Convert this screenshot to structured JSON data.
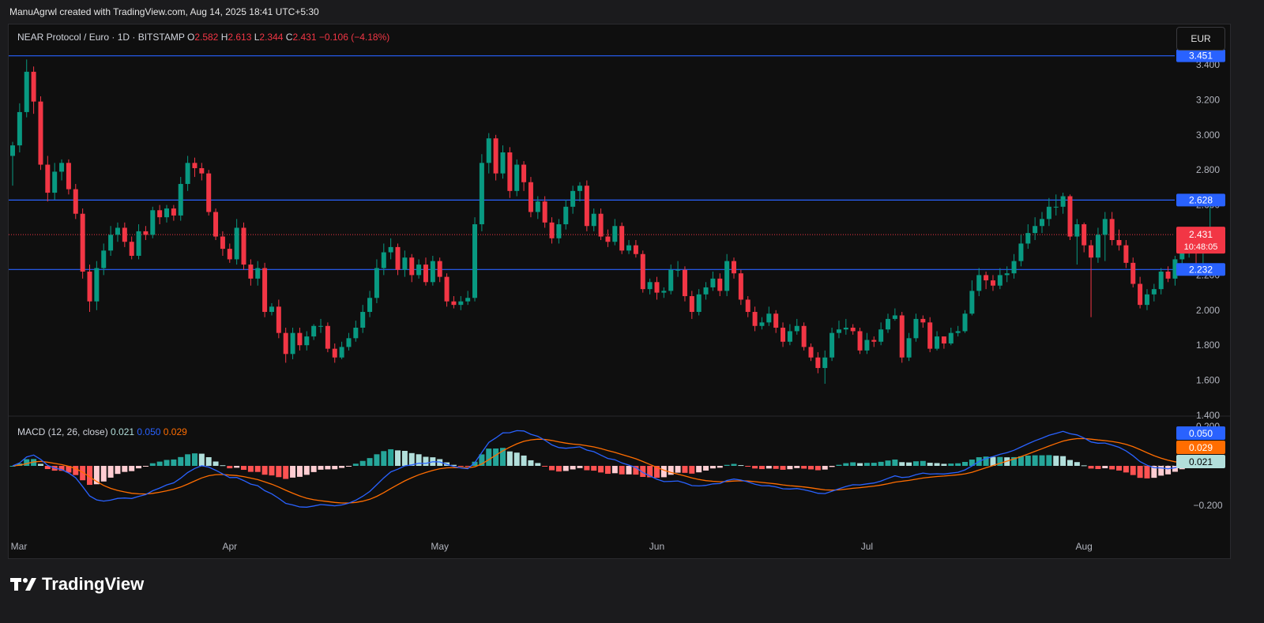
{
  "caption": "ManuAgrwl created with TradingView.com, Aug 14, 2025 18:41 UTC+5:30",
  "header": {
    "symbol": "NEAR Protocol / Euro · 1D · BITSTAMP",
    "o_label": "O",
    "o": "2.582",
    "h_label": "H",
    "h": "2.613",
    "l_label": "L",
    "l": "2.344",
    "c_label": "C",
    "c": "2.431",
    "change": "−0.106 (−4.18%)"
  },
  "currency_button": "EUR",
  "macd_header": {
    "label": "MACD (12, 26, close)",
    "hist": "0.021",
    "macd": "0.050",
    "signal": "0.029"
  },
  "brand": "TradingView",
  "colors": {
    "up": "#089981",
    "down": "#f23645",
    "level": "#2962ff",
    "macd": "#2962ff",
    "signal": "#ff6d00",
    "hist_up_strong": "#26a69a",
    "hist_up_weak": "#b2dfdb",
    "hist_down_strong": "#ff5252",
    "hist_down_weak": "#ffcdd2"
  },
  "chart_data": [
    {
      "type": "candlestick",
      "title": "NEAR Protocol / Euro · 1D · BITSTAMP",
      "y_ticks": [
        "3.400",
        "3.200",
        "3.000",
        "2.800",
        "2.600",
        "2.400",
        "2.200",
        "2.000",
        "1.800",
        "1.600",
        "1.400"
      ],
      "x_ticks": [
        "Mar",
        "Apr",
        "May",
        "Jun",
        "Jul",
        "Aug"
      ],
      "ylim": [
        1.4,
        3.45
      ],
      "horizontal_levels": [
        {
          "value": 3.451,
          "label": "3.451"
        },
        {
          "value": 2.628,
          "label": "2.628"
        },
        {
          "value": 2.232,
          "label": "2.232"
        }
      ],
      "last_price": {
        "value": 2.431,
        "label": "2.431",
        "countdown": "10:48:05"
      },
      "dates": [
        "2025-03-01",
        "2025-03-02",
        "2025-03-03",
        "2025-03-04",
        "2025-03-05",
        "2025-03-06",
        "2025-03-07",
        "2025-03-08",
        "2025-03-09",
        "2025-03-10",
        "2025-03-11",
        "2025-03-12",
        "2025-03-13",
        "2025-03-14",
        "2025-03-15",
        "2025-03-16",
        "2025-03-17",
        "2025-03-18",
        "2025-03-19",
        "2025-03-20",
        "2025-03-21",
        "2025-03-22",
        "2025-03-23",
        "2025-03-24",
        "2025-03-25",
        "2025-03-26",
        "2025-03-27",
        "2025-03-28",
        "2025-03-29",
        "2025-03-30",
        "2025-03-31",
        "2025-04-01",
        "2025-04-02",
        "2025-04-03",
        "2025-04-04",
        "2025-04-05",
        "2025-04-06",
        "2025-04-07",
        "2025-04-08",
        "2025-04-09",
        "2025-04-10",
        "2025-04-11",
        "2025-04-12",
        "2025-04-13",
        "2025-04-14",
        "2025-04-15",
        "2025-04-16",
        "2025-04-17",
        "2025-04-18",
        "2025-04-19",
        "2025-04-20",
        "2025-04-21",
        "2025-04-22",
        "2025-04-23",
        "2025-04-24",
        "2025-04-25",
        "2025-04-26",
        "2025-04-27",
        "2025-04-28",
        "2025-04-29",
        "2025-04-30",
        "2025-05-01",
        "2025-05-02",
        "2025-05-03",
        "2025-05-04",
        "2025-05-05",
        "2025-05-06",
        "2025-05-07",
        "2025-05-08",
        "2025-05-09",
        "2025-05-10",
        "2025-05-11",
        "2025-05-12",
        "2025-05-13",
        "2025-05-14",
        "2025-05-15",
        "2025-05-16",
        "2025-05-17",
        "2025-05-18",
        "2025-05-19",
        "2025-05-20",
        "2025-05-21",
        "2025-05-22",
        "2025-05-23",
        "2025-05-24",
        "2025-05-25",
        "2025-05-26",
        "2025-05-27",
        "2025-05-28",
        "2025-05-29",
        "2025-05-30",
        "2025-05-31",
        "2025-06-01",
        "2025-06-02",
        "2025-06-03",
        "2025-06-04",
        "2025-06-05",
        "2025-06-06",
        "2025-06-07",
        "2025-06-08",
        "2025-06-09",
        "2025-06-10",
        "2025-06-11",
        "2025-06-12",
        "2025-06-13",
        "2025-06-14",
        "2025-06-15",
        "2025-06-16",
        "2025-06-17",
        "2025-06-18",
        "2025-06-19",
        "2025-06-20",
        "2025-06-21",
        "2025-06-22",
        "2025-06-23",
        "2025-06-24",
        "2025-06-25",
        "2025-06-26",
        "2025-06-27",
        "2025-06-28",
        "2025-06-29",
        "2025-06-30",
        "2025-07-01",
        "2025-07-02",
        "2025-07-03",
        "2025-07-04",
        "2025-07-05",
        "2025-07-06",
        "2025-07-07",
        "2025-07-08",
        "2025-07-09",
        "2025-07-10",
        "2025-07-11",
        "2025-07-12",
        "2025-07-13",
        "2025-07-14",
        "2025-07-15",
        "2025-07-16",
        "2025-07-17",
        "2025-07-18",
        "2025-07-19",
        "2025-07-20",
        "2025-07-21",
        "2025-07-22",
        "2025-07-23",
        "2025-07-24",
        "2025-07-25",
        "2025-07-26",
        "2025-07-27",
        "2025-07-28",
        "2025-07-29",
        "2025-07-30",
        "2025-07-31",
        "2025-08-01",
        "2025-08-02",
        "2025-08-03",
        "2025-08-04",
        "2025-08-05",
        "2025-08-06",
        "2025-08-07",
        "2025-08-08",
        "2025-08-09",
        "2025-08-10",
        "2025-08-11",
        "2025-08-12",
        "2025-08-13",
        "2025-08-14"
      ],
      "close": [
        2.94,
        3.13,
        3.36,
        3.19,
        2.83,
        2.67,
        2.79,
        2.84,
        2.69,
        2.55,
        2.22,
        2.05,
        2.24,
        2.34,
        2.43,
        2.47,
        2.39,
        2.31,
        2.45,
        2.43,
        2.57,
        2.53,
        2.58,
        2.54,
        2.72,
        2.84,
        2.81,
        2.78,
        2.56,
        2.42,
        2.35,
        2.29,
        2.47,
        2.26,
        2.18,
        2.24,
        1.99,
        2.02,
        1.87,
        1.75,
        1.87,
        1.8,
        1.85,
        1.91,
        1.91,
        1.78,
        1.73,
        1.79,
        1.84,
        1.9,
        1.99,
        2.07,
        2.24,
        2.33,
        2.36,
        2.23,
        2.3,
        2.2,
        2.26,
        2.16,
        2.28,
        2.19,
        2.05,
        2.03,
        2.05,
        2.07,
        2.49,
        2.84,
        2.98,
        2.78,
        2.9,
        2.68,
        2.83,
        2.73,
        2.56,
        2.62,
        2.5,
        2.41,
        2.49,
        2.59,
        2.68,
        2.71,
        2.48,
        2.55,
        2.42,
        2.39,
        2.48,
        2.34,
        2.37,
        2.32,
        2.12,
        2.16,
        2.1,
        2.11,
        2.23,
        2.23,
        2.08,
        1.99,
        2.09,
        2.13,
        2.18,
        2.11,
        2.28,
        2.21,
        2.06,
        1.99,
        1.91,
        1.93,
        1.98,
        1.9,
        1.82,
        1.88,
        1.91,
        1.79,
        1.73,
        1.67,
        1.73,
        1.87,
        1.89,
        1.9,
        1.88,
        1.77,
        1.83,
        1.82,
        1.89,
        1.95,
        1.97,
        1.73,
        1.84,
        1.95,
        1.93,
        1.78,
        1.85,
        1.81,
        1.87,
        1.88,
        1.98,
        2.11,
        2.2,
        2.17,
        2.14,
        2.2,
        2.21,
        2.28,
        2.38,
        2.44,
        2.48,
        2.52,
        2.59,
        2.59,
        2.65,
        2.42,
        2.49,
        2.37,
        2.3,
        2.43,
        2.52,
        2.4,
        2.37,
        2.27,
        2.15,
        2.03,
        2.09,
        2.12,
        2.22,
        2.18,
        2.29,
        2.34,
        2.41,
        2.33,
        2.34,
        2.44
      ],
      "open": [
        2.88,
        2.94,
        3.13,
        3.36,
        3.19,
        2.83,
        2.67,
        2.79,
        2.84,
        2.69,
        2.55,
        2.22,
        2.05,
        2.24,
        2.34,
        2.43,
        2.47,
        2.39,
        2.31,
        2.45,
        2.43,
        2.57,
        2.53,
        2.58,
        2.54,
        2.72,
        2.84,
        2.81,
        2.78,
        2.56,
        2.42,
        2.35,
        2.29,
        2.47,
        2.26,
        2.18,
        2.24,
        1.99,
        2.02,
        1.87,
        1.75,
        1.87,
        1.8,
        1.85,
        1.91,
        1.91,
        1.78,
        1.73,
        1.79,
        1.84,
        1.9,
        1.99,
        2.07,
        2.24,
        2.33,
        2.36,
        2.23,
        2.3,
        2.2,
        2.26,
        2.16,
        2.28,
        2.19,
        2.05,
        2.03,
        2.05,
        2.07,
        2.49,
        2.84,
        2.98,
        2.78,
        2.9,
        2.68,
        2.83,
        2.73,
        2.56,
        2.62,
        2.5,
        2.41,
        2.49,
        2.59,
        2.68,
        2.71,
        2.48,
        2.55,
        2.42,
        2.39,
        2.48,
        2.34,
        2.37,
        2.32,
        2.12,
        2.16,
        2.1,
        2.11,
        2.23,
        2.23,
        2.08,
        1.99,
        2.09,
        2.13,
        2.18,
        2.11,
        2.28,
        2.21,
        2.06,
        1.99,
        1.91,
        1.93,
        1.98,
        1.9,
        1.82,
        1.88,
        1.91,
        1.79,
        1.73,
        1.67,
        1.73,
        1.87,
        1.89,
        1.9,
        1.88,
        1.77,
        1.83,
        1.82,
        1.89,
        1.95,
        1.97,
        1.73,
        1.84,
        1.95,
        1.93,
        1.78,
        1.85,
        1.81,
        1.87,
        1.88,
        1.98,
        2.11,
        2.2,
        2.17,
        2.14,
        2.2,
        2.21,
        2.28,
        2.38,
        2.44,
        2.48,
        2.52,
        2.59,
        2.59,
        2.65,
        2.42,
        2.49,
        2.37,
        2.3,
        2.43,
        2.52,
        2.4,
        2.37,
        2.27,
        2.15,
        2.03,
        2.09,
        2.12,
        2.22,
        2.18,
        2.29,
        2.34,
        2.41,
        2.33,
        2.34,
        2.58
      ],
      "high": [
        2.96,
        3.18,
        3.43,
        3.39,
        3.22,
        2.88,
        2.84,
        2.86,
        2.86,
        2.72,
        2.58,
        2.26,
        2.28,
        2.38,
        2.48,
        2.5,
        2.5,
        2.42,
        2.49,
        2.48,
        2.59,
        2.6,
        2.6,
        2.6,
        2.76,
        2.88,
        2.87,
        2.84,
        2.8,
        2.58,
        2.45,
        2.38,
        2.52,
        2.5,
        2.29,
        2.28,
        2.27,
        2.04,
        2.06,
        1.9,
        1.9,
        1.9,
        1.88,
        1.92,
        1.95,
        1.93,
        1.81,
        1.82,
        1.87,
        1.94,
        2.03,
        2.11,
        2.29,
        2.38,
        2.41,
        2.38,
        2.34,
        2.32,
        2.29,
        2.3,
        2.31,
        2.3,
        2.21,
        2.08,
        2.08,
        2.11,
        2.53,
        2.89,
        3.01,
        3.0,
        2.94,
        2.93,
        2.86,
        2.85,
        2.76,
        2.65,
        2.65,
        2.53,
        2.52,
        2.63,
        2.71,
        2.73,
        2.74,
        2.58,
        2.58,
        2.46,
        2.52,
        2.5,
        2.4,
        2.4,
        2.34,
        2.18,
        2.19,
        2.13,
        2.26,
        2.28,
        2.25,
        2.11,
        2.12,
        2.16,
        2.22,
        2.21,
        2.32,
        2.3,
        2.23,
        2.08,
        2.02,
        1.96,
        2.02,
        2.0,
        1.93,
        1.92,
        1.95,
        1.93,
        1.81,
        1.76,
        1.77,
        1.9,
        1.94,
        1.95,
        1.92,
        1.9,
        1.87,
        1.85,
        1.93,
        1.98,
        2.01,
        1.99,
        1.87,
        1.98,
        1.97,
        1.96,
        1.88,
        1.85,
        1.9,
        1.91,
        2.0,
        2.17,
        2.24,
        2.22,
        2.2,
        2.24,
        2.25,
        2.32,
        2.43,
        2.49,
        2.53,
        2.56,
        2.64,
        2.66,
        2.67,
        2.66,
        2.52,
        2.5,
        2.4,
        2.47,
        2.56,
        2.56,
        2.46,
        2.4,
        2.3,
        2.19,
        2.12,
        2.15,
        2.24,
        2.25,
        2.31,
        2.36,
        2.45,
        2.44,
        2.38,
        2.613
      ],
      "low": [
        2.71,
        2.9,
        3.1,
        3.12,
        2.8,
        2.62,
        2.63,
        2.74,
        2.66,
        2.52,
        2.18,
        1.99,
        2.0,
        2.2,
        2.31,
        2.39,
        2.36,
        2.29,
        2.29,
        2.4,
        2.41,
        2.49,
        2.5,
        2.51,
        2.51,
        2.68,
        2.76,
        2.74,
        2.54,
        2.4,
        2.31,
        2.27,
        2.26,
        2.23,
        2.14,
        2.14,
        1.96,
        1.97,
        1.84,
        1.7,
        1.72,
        1.77,
        1.77,
        1.83,
        1.87,
        1.76,
        1.7,
        1.72,
        1.77,
        1.82,
        1.87,
        1.96,
        2.04,
        2.2,
        2.29,
        2.2,
        2.19,
        2.16,
        2.18,
        2.14,
        2.14,
        2.16,
        2.02,
        2.01,
        2.0,
        2.03,
        2.05,
        2.45,
        2.78,
        2.74,
        2.75,
        2.64,
        2.65,
        2.68,
        2.53,
        2.52,
        2.47,
        2.38,
        2.38,
        2.46,
        2.55,
        2.62,
        2.45,
        2.45,
        2.4,
        2.36,
        2.37,
        2.32,
        2.32,
        2.3,
        2.1,
        2.09,
        2.06,
        2.07,
        2.09,
        2.19,
        2.05,
        1.95,
        1.97,
        2.06,
        2.11,
        2.08,
        2.08,
        2.18,
        2.03,
        1.96,
        1.88,
        1.89,
        1.91,
        1.87,
        1.79,
        1.8,
        1.86,
        1.77,
        1.71,
        1.64,
        1.58,
        1.71,
        1.84,
        1.86,
        1.86,
        1.75,
        1.75,
        1.79,
        1.8,
        1.87,
        1.94,
        1.7,
        1.71,
        1.82,
        1.9,
        1.76,
        1.77,
        1.78,
        1.8,
        1.85,
        1.87,
        1.97,
        2.08,
        2.12,
        2.11,
        2.12,
        2.16,
        2.18,
        2.25,
        2.35,
        2.4,
        2.44,
        2.48,
        2.54,
        2.55,
        2.4,
        2.26,
        2.33,
        1.96,
        2.27,
        2.28,
        2.37,
        2.34,
        2.24,
        2.13,
        2.01,
        2.0,
        2.05,
        2.09,
        2.16,
        2.14,
        2.25,
        2.3,
        2.22,
        2.24,
        2.344
      ]
    },
    {
      "type": "macd",
      "title": "MACD (12, 26, close)",
      "y_ticks": [
        "0.200",
        "−0.200"
      ],
      "ylim": [
        -0.28,
        0.22
      ],
      "last_values": {
        "histogram": 0.021,
        "macd": 0.05,
        "signal": 0.029
      }
    }
  ]
}
